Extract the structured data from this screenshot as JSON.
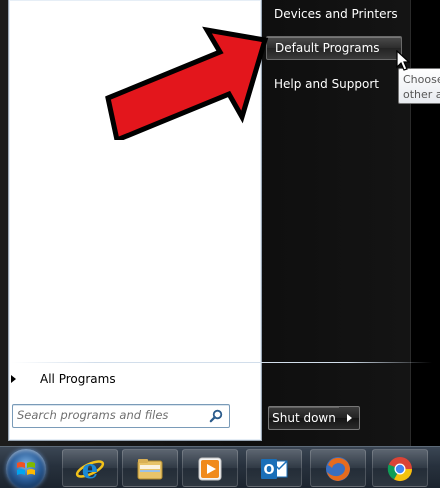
{
  "start_menu": {
    "left_pane": {
      "all_programs_label": "All Programs",
      "search_placeholder": "Search programs and files"
    },
    "right_pane": {
      "items": [
        {
          "label": "Devices and Printers"
        },
        {
          "label": "Default Programs",
          "selected": true
        },
        {
          "label": "Help and Support"
        }
      ],
      "shutdown_label": "Shut down"
    },
    "tooltip": {
      "line1": "Choose",
      "line2": "other a"
    }
  },
  "taskbar": {
    "items": [
      {
        "name": "start-button",
        "icon": "windows-logo-icon"
      },
      {
        "name": "internet-explorer",
        "icon": "internet-explorer-icon"
      },
      {
        "name": "windows-explorer",
        "icon": "folder-icon"
      },
      {
        "name": "media-player",
        "icon": "media-player-icon"
      },
      {
        "name": "outlook",
        "icon": "outlook-icon"
      },
      {
        "name": "firefox",
        "icon": "firefox-icon"
      },
      {
        "name": "chrome",
        "icon": "chrome-icon"
      }
    ]
  },
  "colors": {
    "highlight_arrow": "#e3161c",
    "menu_background": "#0e0e0e",
    "taskbar": "#27313d"
  }
}
